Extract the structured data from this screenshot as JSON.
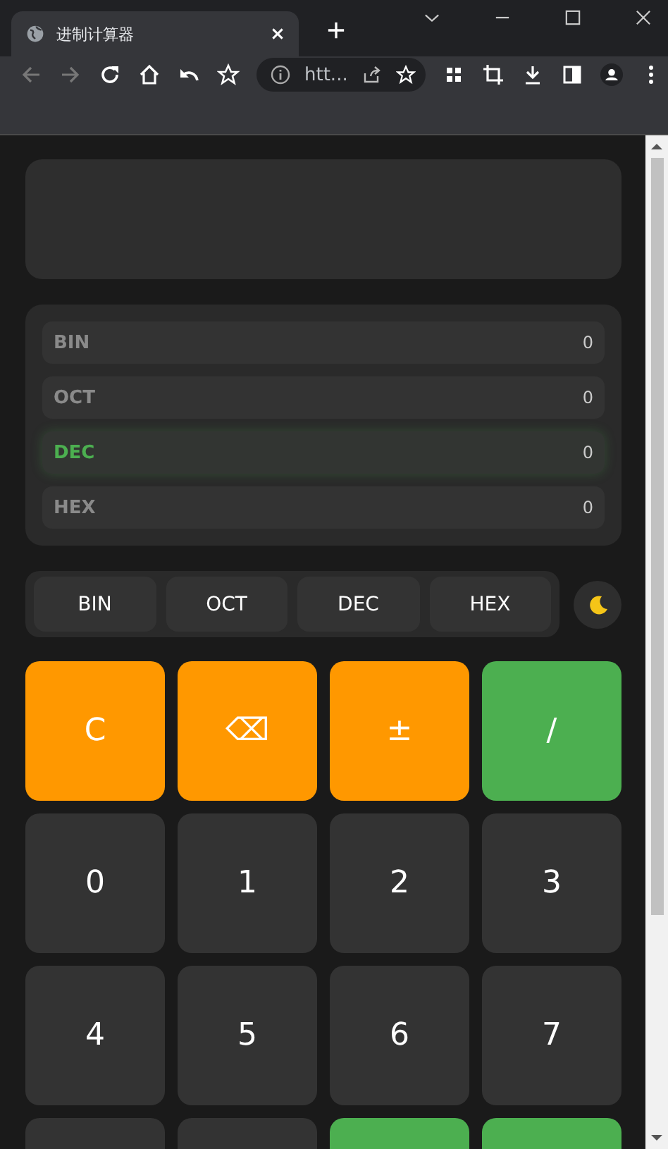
{
  "browser": {
    "tab_title": "进制计算器",
    "address": "htt..."
  },
  "conversions": [
    {
      "label": "BIN",
      "value": "0",
      "selected": false
    },
    {
      "label": "OCT",
      "value": "0",
      "selected": false
    },
    {
      "label": "DEC",
      "value": "0",
      "selected": true
    },
    {
      "label": "HEX",
      "value": "0",
      "selected": false
    }
  ],
  "modes": [
    "BIN",
    "OCT",
    "DEC",
    "HEX"
  ],
  "keys": [
    {
      "label": "C",
      "kind": "action"
    },
    {
      "label": "⌫",
      "kind": "action"
    },
    {
      "label": "±",
      "kind": "action"
    },
    {
      "label": "/",
      "kind": "operator"
    },
    {
      "label": "0",
      "kind": "digit"
    },
    {
      "label": "1",
      "kind": "digit"
    },
    {
      "label": "2",
      "kind": "digit"
    },
    {
      "label": "3",
      "kind": "digit"
    },
    {
      "label": "4",
      "kind": "digit"
    },
    {
      "label": "5",
      "kind": "digit"
    },
    {
      "label": "6",
      "kind": "digit"
    },
    {
      "label": "7",
      "kind": "digit"
    },
    {
      "kind": "digit"
    },
    {
      "kind": "digit"
    },
    {
      "kind": "operator"
    },
    {
      "kind": "operator"
    }
  ]
}
